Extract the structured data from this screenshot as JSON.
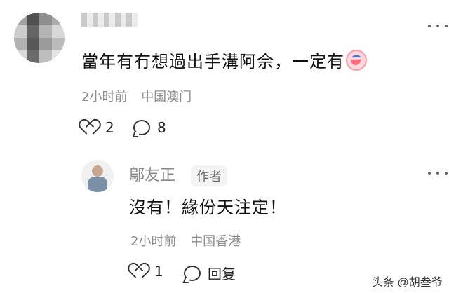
{
  "comment": {
    "username_text": "",
    "text": "當年有冇想過出手溝阿佘，一定有",
    "emoji": "crying-laughing-face",
    "time": "2小时前",
    "location": "中国澳门",
    "likes": "2",
    "replies": "8"
  },
  "reply": {
    "username": "鄔友正",
    "badge": "作者",
    "text": "沒有！緣份天注定！",
    "time": "2小时前",
    "location": "中国香港",
    "likes": "1",
    "reply_label": "回复"
  },
  "watermark": "头条 @胡叁爷"
}
